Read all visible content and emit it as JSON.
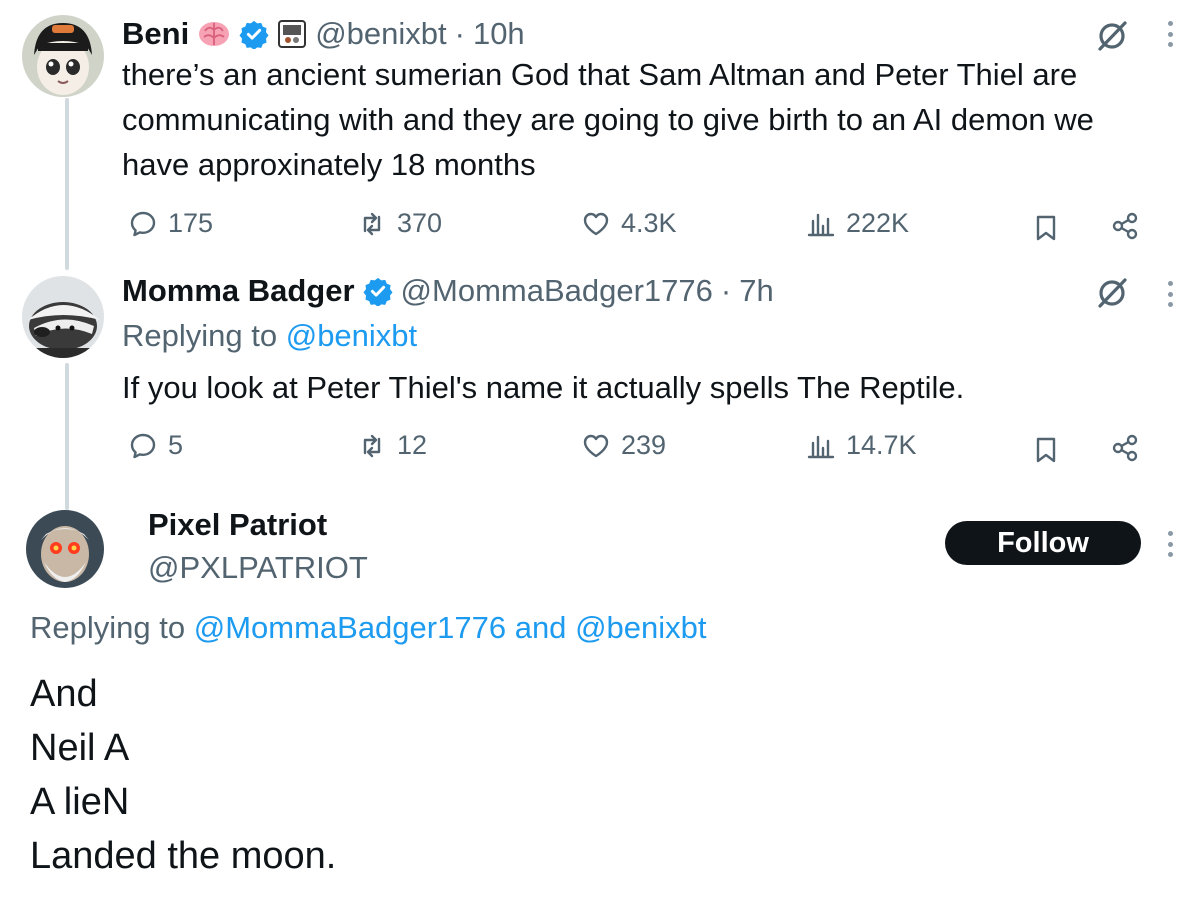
{
  "tweets": [
    {
      "author_name": "Beni",
      "handle": "@benixbt",
      "separator": "·",
      "time": "10h",
      "text": "there’s an ancient sumerian God that Sam Altman and Peter Thiel are communicating with and they are going to give birth to an AI demon we have approxinately 18 months",
      "replies": "175",
      "reposts": "370",
      "likes": "4.3K",
      "views": "222K",
      "name_icons": [
        "brain-emoji-icon",
        "verified-badge-icon",
        "affiliate-badge-icon"
      ]
    },
    {
      "author_name": "Momma Badger",
      "handle": "@MommaBadger1776",
      "separator": "·",
      "time": "7h",
      "replying_prefix": "Replying to",
      "replying_handle": "@benixbt",
      "text": "If you look at Peter Thiel's name it actually spells The Reptile.",
      "replies": "5",
      "reposts": "12",
      "likes": "239",
      "views": "14.7K",
      "name_icons": [
        "verified-badge-icon"
      ]
    }
  ],
  "main_tweet": {
    "author_name": "Pixel Patriot",
    "handle": "@PXLPATRIOT",
    "follow_label": "Follow",
    "replying_prefix": "Replying to",
    "replying_handle_1": "@MommaBadger1776",
    "replying_and": "and",
    "replying_handle_2": "@benixbt",
    "lines": [
      "And",
      "Neil A",
      "A lieN",
      "Landed the moon."
    ]
  },
  "colors": {
    "text": "#0f1419",
    "secondary": "#536471",
    "accent": "#1d9bf0",
    "thread_line": "#cfd9de",
    "follow_bg": "#0f1419"
  }
}
